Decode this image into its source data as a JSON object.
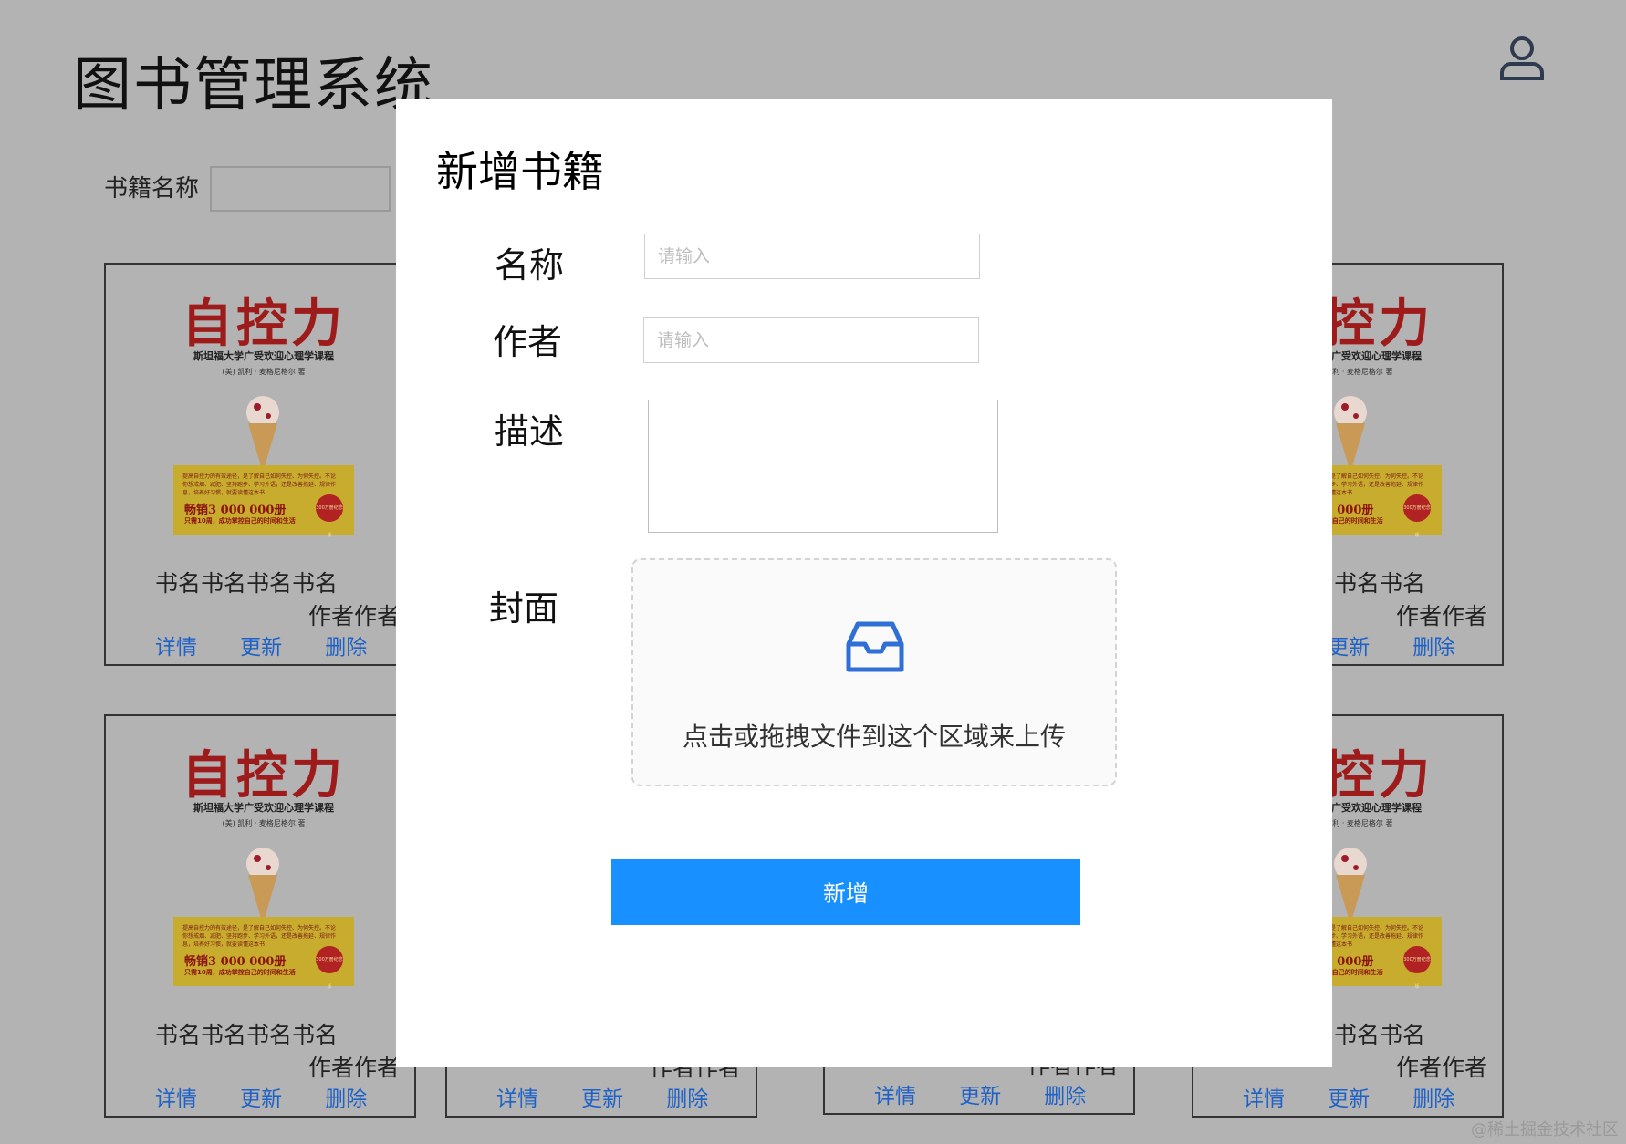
{
  "app": {
    "title": "图书管理系统"
  },
  "search": {
    "label": "书籍名称"
  },
  "book": {
    "cover_title": "自控力",
    "cover_subtitle": "斯坦福大学广受欢迎心理学课程",
    "cover_author": "(美) 凯利 · 麦格尼格尔 著",
    "cover_band_text": "提高自控力的有效途径，是了解自己如何失控、为何失控。不论你想戒烟、减肥、坚持跑步、学习外语，还是改善拖延、规律作息，培养好习惯，就要读懂这本书",
    "cover_band_sales": "畅销3 000 000册",
    "cover_band_tagline": "只需10周，成功掌控自己的时间和生活",
    "cover_seal": "300万册纪念版",
    "name": "书名书名书名书名",
    "author": "作者作者",
    "actions": {
      "detail": "详情",
      "update": "更新",
      "delete": "删除"
    }
  },
  "modal": {
    "title": "新增书籍",
    "fields": {
      "name": {
        "label": "名称",
        "placeholder": "请输入"
      },
      "author": {
        "label": "作者",
        "placeholder": "请输入"
      },
      "description": {
        "label": "描述"
      },
      "cover": {
        "label": "封面"
      }
    },
    "upload_text": "点击或拖拽文件到这个区域来上传",
    "submit_label": "新增"
  },
  "watermark": "@稀土掘金技术社区",
  "colors": {
    "overlay": "#b3b3b3",
    "primary": "#1890ff",
    "link": "#1e62c8",
    "upload_icon": "#2f6fd6"
  },
  "icons": {
    "user": "user-icon",
    "upload": "inbox-icon"
  }
}
